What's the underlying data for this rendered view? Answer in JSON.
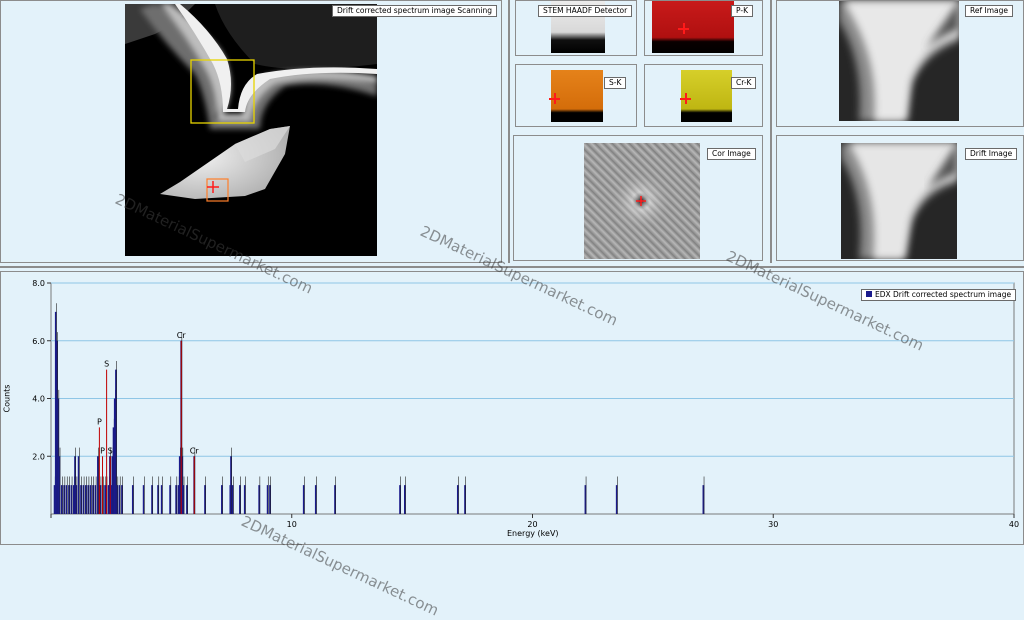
{
  "panels": {
    "main_scan": {
      "label": "Drift corrected spectrum image Scanning"
    },
    "haadf": {
      "label": "STEM HAADF Detector"
    },
    "p_k": {
      "label": "P-K"
    },
    "s_k": {
      "label": "S-K"
    },
    "cr_k": {
      "label": "Cr-K"
    },
    "cor_image": {
      "label": "Cor Image"
    },
    "ref_image": {
      "label": "Ref Image"
    },
    "drift_image": {
      "label": "Drift Image"
    }
  },
  "watermark": {
    "text": "2DMaterialSupermarket.com"
  },
  "colors": {
    "background": "#e3f2fa",
    "bar_fill": "#1a1a8c",
    "peak_line": "#c00000",
    "crosshair": "#ff1a1a",
    "roi_yellow": "#e8d400",
    "roi_orange": "#ff7f2a",
    "p_map": "#c01818",
    "s_map": "#e07a10",
    "cr_map": "#d0c820"
  },
  "chart_data": {
    "type": "bar",
    "title": "",
    "xlabel": "Energy (keV)",
    "ylabel": "Counts",
    "xlim": [
      0,
      40
    ],
    "ylim": [
      0,
      8
    ],
    "xticks": [
      0,
      10,
      20,
      30,
      40
    ],
    "xtick_labels": [
      "",
      "10",
      "20",
      "30",
      "40"
    ],
    "yticks": [
      2,
      4,
      6,
      8
    ],
    "ytick_labels": [
      "2.0",
      "4.0",
      "6.0",
      "8.0"
    ],
    "grid": true,
    "legend": {
      "placement": "top-right",
      "entries": [
        "EDX Drift corrected spectrum image"
      ]
    },
    "series": [
      {
        "name": "EDX Drift corrected spectrum image",
        "points": [
          [
            0.15,
            1
          ],
          [
            0.2,
            7
          ],
          [
            0.25,
            6
          ],
          [
            0.3,
            4
          ],
          [
            0.35,
            2
          ],
          [
            0.45,
            1
          ],
          [
            0.55,
            1
          ],
          [
            0.65,
            1
          ],
          [
            0.75,
            1
          ],
          [
            0.85,
            1
          ],
          [
            0.95,
            1
          ],
          [
            1.0,
            2
          ],
          [
            1.05,
            1
          ],
          [
            1.15,
            2
          ],
          [
            1.25,
            1
          ],
          [
            1.35,
            1
          ],
          [
            1.45,
            1
          ],
          [
            1.55,
            1
          ],
          [
            1.65,
            1
          ],
          [
            1.75,
            1
          ],
          [
            1.85,
            1
          ],
          [
            1.95,
            2
          ],
          [
            2.05,
            1
          ],
          [
            2.15,
            1
          ],
          [
            2.25,
            1
          ],
          [
            2.3,
            1
          ],
          [
            2.4,
            1
          ],
          [
            2.45,
            2
          ],
          [
            2.5,
            1
          ],
          [
            2.55,
            2
          ],
          [
            2.6,
            3
          ],
          [
            2.65,
            4
          ],
          [
            2.7,
            5
          ],
          [
            2.75,
            1
          ],
          [
            2.85,
            1
          ],
          [
            2.95,
            1
          ],
          [
            3.4,
            1
          ],
          [
            3.85,
            1
          ],
          [
            4.2,
            1
          ],
          [
            4.45,
            1
          ],
          [
            4.6,
            1
          ],
          [
            4.95,
            1
          ],
          [
            5.2,
            1
          ],
          [
            5.3,
            1
          ],
          [
            5.35,
            2
          ],
          [
            5.41,
            6
          ],
          [
            5.45,
            2
          ],
          [
            5.5,
            1
          ],
          [
            5.65,
            1
          ],
          [
            5.95,
            2
          ],
          [
            6.4,
            1
          ],
          [
            7.1,
            1
          ],
          [
            7.45,
            1
          ],
          [
            7.48,
            2
          ],
          [
            7.55,
            1
          ],
          [
            7.85,
            1
          ],
          [
            8.05,
            1
          ],
          [
            8.65,
            1
          ],
          [
            9.0,
            1
          ],
          [
            9.1,
            1
          ],
          [
            10.5,
            1
          ],
          [
            11.0,
            1
          ],
          [
            11.8,
            1
          ],
          [
            14.5,
            1
          ],
          [
            14.7,
            1
          ],
          [
            16.9,
            1
          ],
          [
            17.2,
            1
          ],
          [
            22.2,
            1
          ],
          [
            23.5,
            1
          ],
          [
            27.1,
            1
          ]
        ]
      }
    ],
    "peak_labels": [
      {
        "text": "Cr",
        "x": 5.41,
        "y": 6.0
      },
      {
        "text": "S",
        "x": 2.31,
        "y": 5.0
      },
      {
        "text": "P",
        "x": 2.01,
        "y": 3.0
      },
      {
        "text": "P",
        "x": 2.14,
        "y": 2.0
      },
      {
        "text": "S",
        "x": 2.46,
        "y": 2.0
      },
      {
        "text": "Cr",
        "x": 5.95,
        "y": 2.0
      }
    ]
  }
}
